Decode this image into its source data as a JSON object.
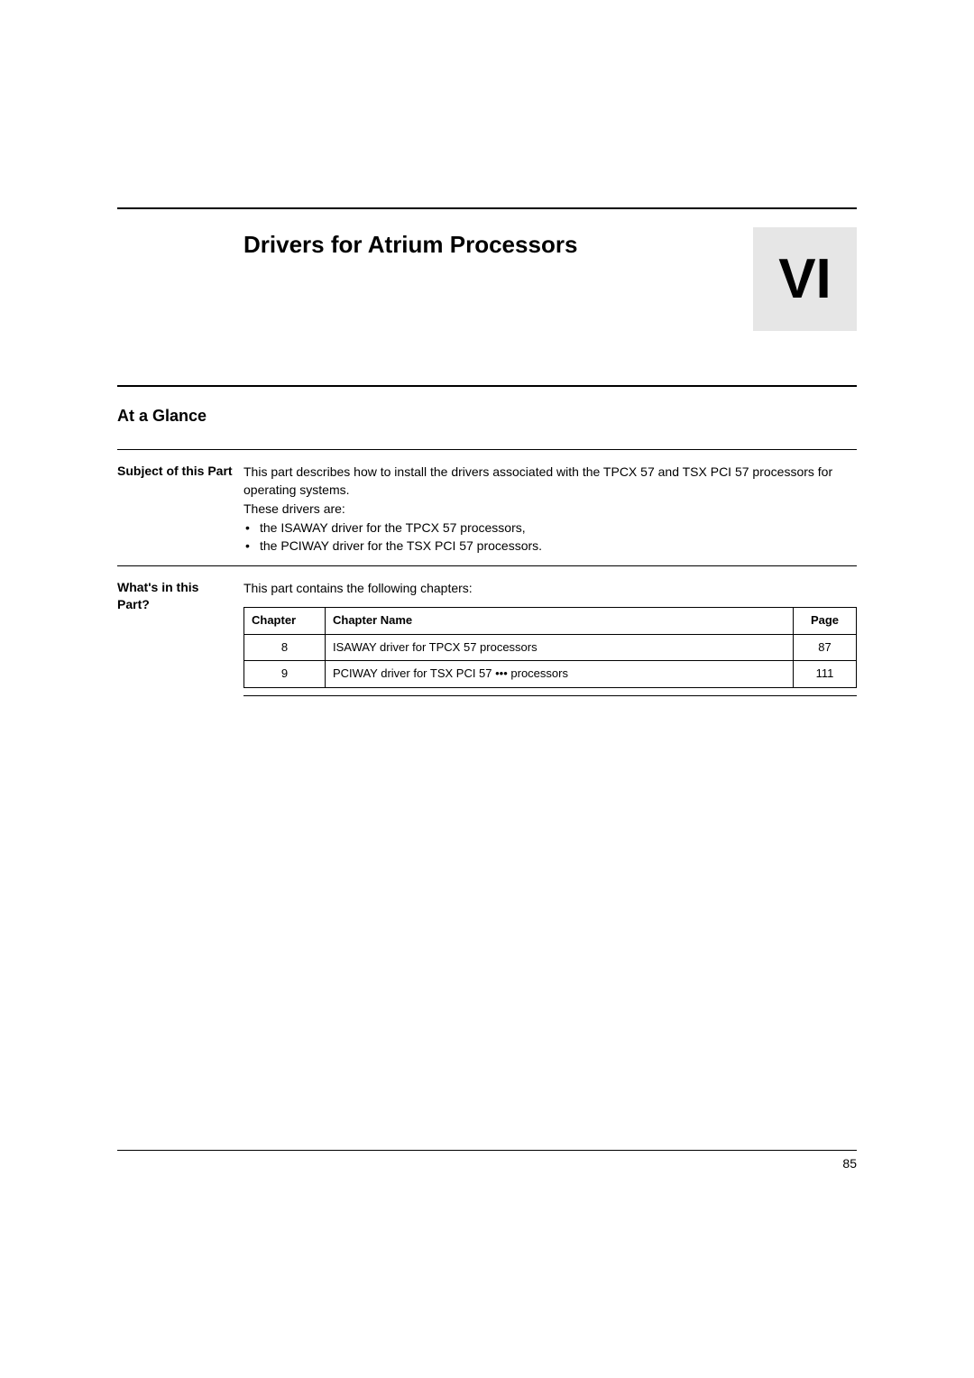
{
  "part": {
    "title": "Drivers for Atrium Processors",
    "number": "VI"
  },
  "glance": {
    "heading": "At a Glance"
  },
  "subject": {
    "label": "Subject of this Part",
    "intro": "This part describes how to install the drivers associated with the TPCX 57 and TSX PCI 57 processors for operating systems.",
    "drivers_label": "These drivers are:",
    "bullets": [
      "the ISAWAY driver for the TPCX 57 processors,",
      "the PCIWAY driver for the TSX PCI 57 processors."
    ]
  },
  "whats_in": {
    "label": "What's in this Part?",
    "intro": "This part contains the following chapters:",
    "table_headers": {
      "chapter": "Chapter",
      "name": "Chapter Name",
      "page": "Page"
    },
    "rows": [
      {
        "chapter": "8",
        "name": "ISAWAY driver for TPCX 57 processors",
        "page": "87"
      },
      {
        "chapter": "9",
        "name": "PCIWAY driver for TSX PCI 57 ••• processors",
        "page": "111"
      }
    ]
  },
  "page_number": "85"
}
